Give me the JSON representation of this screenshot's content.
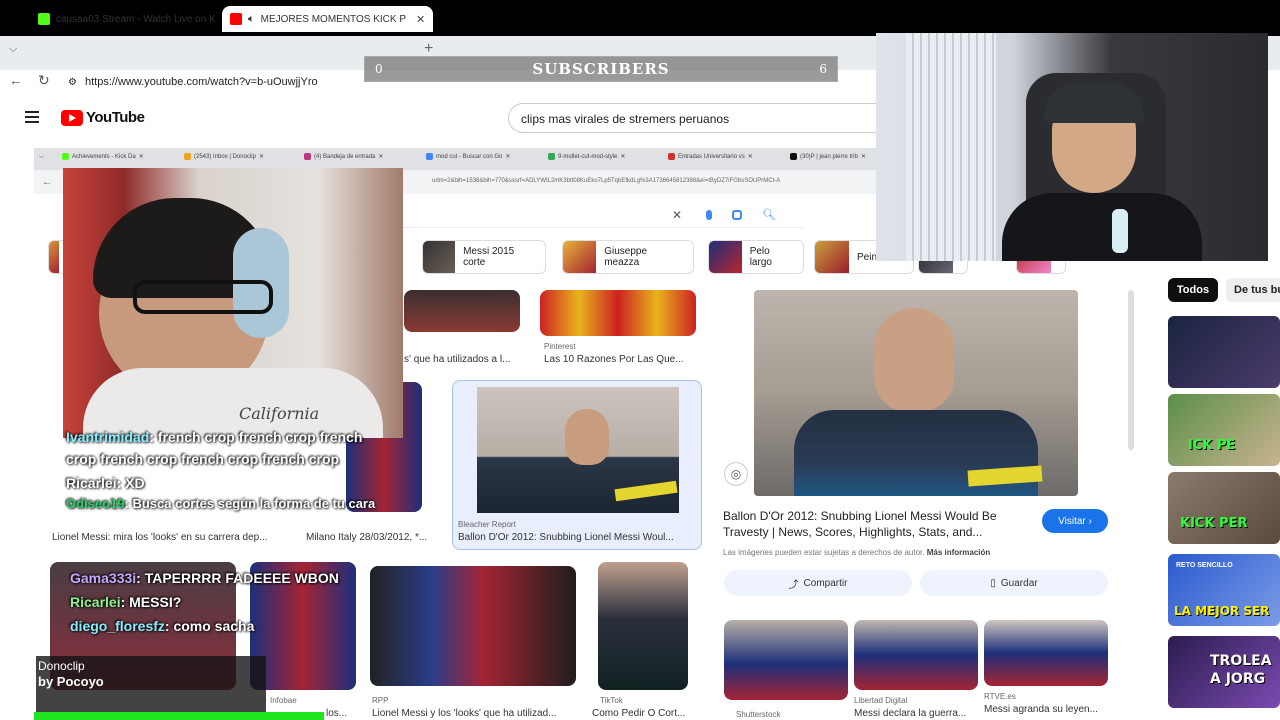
{
  "browser": {
    "tabs": [
      {
        "title": "causaa03 Stream - Watch Live on K",
        "color": "#53fc18"
      },
      {
        "title": "MEJORES MOMENTOS KICK P",
        "color": "#ff0000"
      }
    ],
    "url": "https://www.youtube.com/watch?v=b-uOuwjjYro"
  },
  "youtube": {
    "logo_text": "YouTube",
    "search_value": "clips mas virales de stremers peruanos"
  },
  "overlay": {
    "subscribers_label": "SUBSCRIBERS",
    "subscribers_left": "0",
    "subscribers_right": "6",
    "shirt_text": "California"
  },
  "inner_browser": {
    "tabs": [
      "Achievements - Kick Da",
      "(2543) Inbox | Donoclip",
      "(4) Bandeja de entrada",
      "mod cut - Buscar con Go",
      "9-mullet-cut-mod-style",
      "Entradas Universitario vs",
      "(30)P | jean pierre trib"
    ],
    "url": "udm=2&bih=1536&bih=770&sxsrf=ADLYWIL2mK3btt08KuEko7Lp5TqbEfkdLg%3A1736645812398&ei=tByDZ7iFGbsSOUPrMCt-A"
  },
  "chips": [
    {
      "label": "Messi 2015 corte"
    },
    {
      "label": "Giuseppe meazza"
    },
    {
      "label": "Pelo largo"
    },
    {
      "label": "Peinados"
    }
  ],
  "results": [
    {
      "source": "Pinterest",
      "caption": "Las 10 Razones Por Las Que..."
    },
    {
      "caption": "s' que ha utilizados a l..."
    },
    {
      "source": "Bleacher Report",
      "caption": "Ballon D'Or 2012: Snubbing Lionel Messi Woul..."
    },
    {
      "caption": "Lionel Messi: mira los 'looks' en su carrera dep..."
    },
    {
      "caption": "Milano Italy 28/03/2012, *..."
    },
    {
      "source": "RPP",
      "caption": "Lionel Messi y los 'looks' que ha utilizad..."
    },
    {
      "source": "TikTok",
      "caption": "Como Pedir O Cort..."
    },
    {
      "source": "Shutterstock",
      "caption": ""
    },
    {
      "source": "Libertad Digital",
      "caption": "Messi declara la guerra..."
    },
    {
      "source": "RTVE.es",
      "caption": "Messi agranda su leyen..."
    },
    {
      "source": "Infobae",
      "caption": "los..."
    }
  ],
  "panel": {
    "title": "Ballon D'Or 2012: Snubbing Lionel Messi Would Be Travesty | News, Scores, Highlights, Stats, and...",
    "visit_label": "Visitar",
    "disclaimer": "Las imágenes pueden estar sujetas a derechos de autor.",
    "more_info": "Más información",
    "share_label": "Compartir",
    "save_label": "Guardar"
  },
  "chat": [
    {
      "user": "Ivantrimidad",
      "text": ": french crop french crop french crop french crop french crop french crop"
    },
    {
      "user": "Ricarlei",
      "text": ": XD"
    },
    {
      "user": "Odiseo19",
      "text": ": Busca cortes según la forma de tu cara"
    }
  ],
  "chat2": [
    {
      "user": "Gama333i",
      "text": ": TAPERRRR FADEEEE WBON"
    },
    {
      "user": "Ricarlei",
      "text": ": MESSI?"
    },
    {
      "user": "diego_floresfz",
      "text": ": como sacha"
    }
  ],
  "donoclip": {
    "title": "Donoclip",
    "by": "by Pocoyo"
  },
  "sidebar": {
    "filters": [
      "Todos",
      "De tus bú"
    ],
    "thumbs": [
      {
        "text": "",
        "bg": "#2a2f4a"
      },
      {
        "text": "ICK PE",
        "bg": "#3b8f3a"
      },
      {
        "text": "KICK PER",
        "bg": "#5a4a3f"
      },
      {
        "text": "LA MEJOR SER",
        "bg": "#3a5fbf",
        "sub": "RETO SENCILLO"
      },
      {
        "text": "TROLEA A JORG",
        "bg": "#3c2b6b"
      }
    ]
  }
}
